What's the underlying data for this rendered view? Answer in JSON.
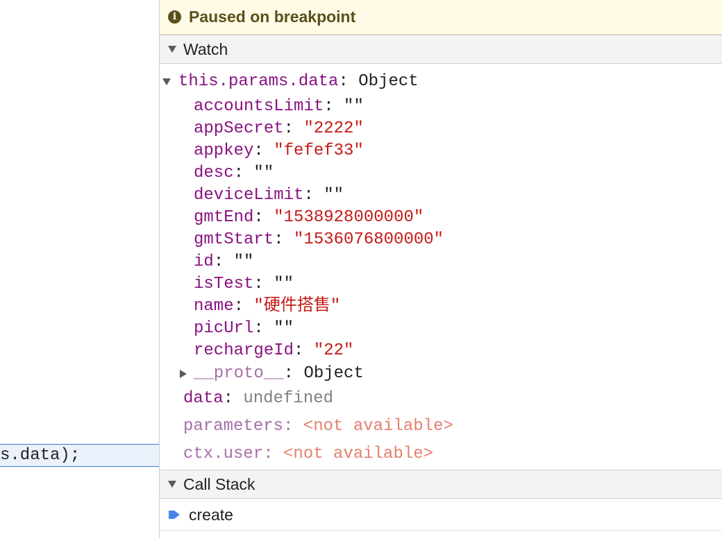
{
  "code_pane": {
    "current_line": "s.data);"
  },
  "banner": {
    "text": "Paused on breakpoint"
  },
  "watch": {
    "title": "Watch",
    "root": {
      "expr": "this.params.data",
      "sep": ": ",
      "type": "Object"
    },
    "properties": [
      {
        "key": "accountsLimit",
        "value": "\"\""
      },
      {
        "key": "appSecret",
        "value": "\"2222\""
      },
      {
        "key": "appkey",
        "value": "\"fefef33\""
      },
      {
        "key": "desc",
        "value": "\"\""
      },
      {
        "key": "deviceLimit",
        "value": "\"\""
      },
      {
        "key": "gmtEnd",
        "value": "\"1538928000000\""
      },
      {
        "key": "gmtStart",
        "value": "\"1536076800000\""
      },
      {
        "key": "id",
        "value": "\"\""
      },
      {
        "key": "isTest",
        "value": "\"\""
      },
      {
        "key": "name",
        "value": "\"硬件搭售\""
      },
      {
        "key": "picUrl",
        "value": "\"\""
      },
      {
        "key": "rechargeId",
        "value": "\"22\""
      }
    ],
    "proto": {
      "key": "__proto__",
      "type": "Object"
    },
    "expressions": [
      {
        "key": "data",
        "value": "undefined"
      },
      {
        "key": "parameters",
        "value": "<not available>"
      },
      {
        "key": "ctx.user",
        "value": "<not available>"
      }
    ]
  },
  "call_stack": {
    "title": "Call Stack",
    "frames": [
      {
        "name": "create"
      }
    ]
  },
  "colors": {
    "key": "#881280",
    "string": "#c41a16",
    "not_available": "#e5806e",
    "banner_bg": "#fffbe6",
    "accent": "#3f7ad6"
  }
}
